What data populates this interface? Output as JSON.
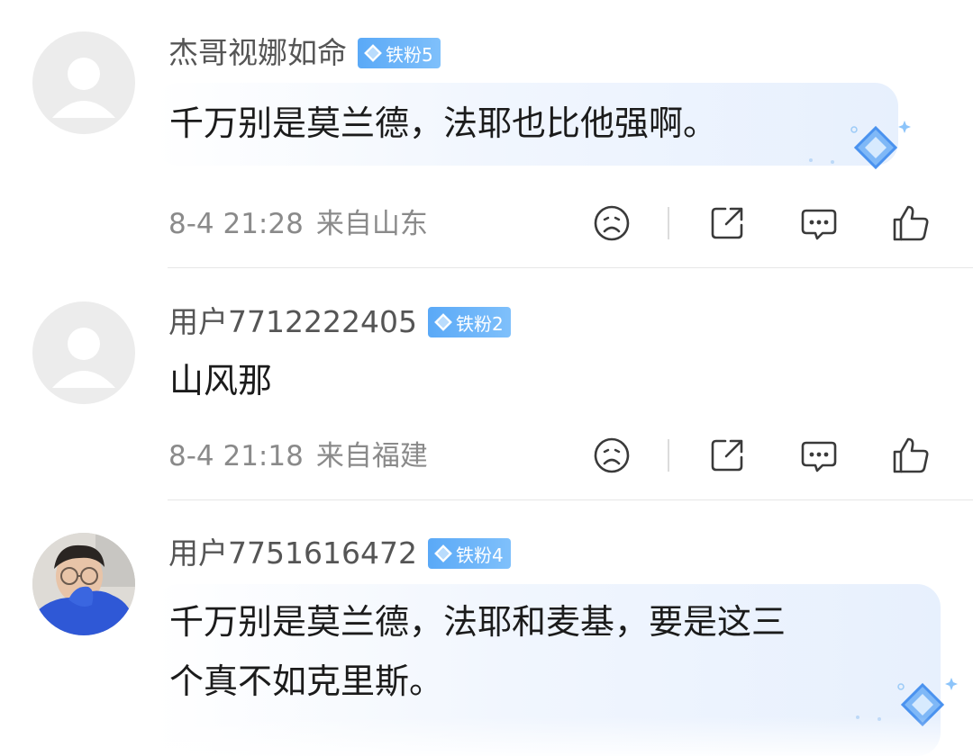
{
  "comments": [
    {
      "username": "杰哥视娜如命",
      "badge": "铁粉5",
      "content_lines": [
        "千万别是莫兰德，法耶也比他强啊。"
      ],
      "date": "8-4 21:28",
      "region": "来自山东",
      "avatar": "default-avatar"
    },
    {
      "username": "用户7712222405",
      "badge": "铁粉2",
      "content_lines": [
        "山风那"
      ],
      "date": "8-4 21:18",
      "region": "来自福建",
      "avatar": "default-avatar"
    },
    {
      "username": "用户7751616472",
      "badge": "铁粉4",
      "content_lines": [
        "千万别是莫兰德，法耶和麦基，要是这三",
        "个真不如克里斯。"
      ],
      "avatar": "user-photo-avatar"
    }
  ],
  "icons": {
    "badge": "diamond-icon",
    "actions": [
      "sad-face-icon",
      "share-icon",
      "comment-icon",
      "thumbs-up-icon"
    ]
  },
  "colors": {
    "badge": "#5aa9f7",
    "bubble": "#e7f0fd",
    "username": "#555555",
    "meta": "#8a8a8a",
    "icon": "#3a3a3a"
  }
}
